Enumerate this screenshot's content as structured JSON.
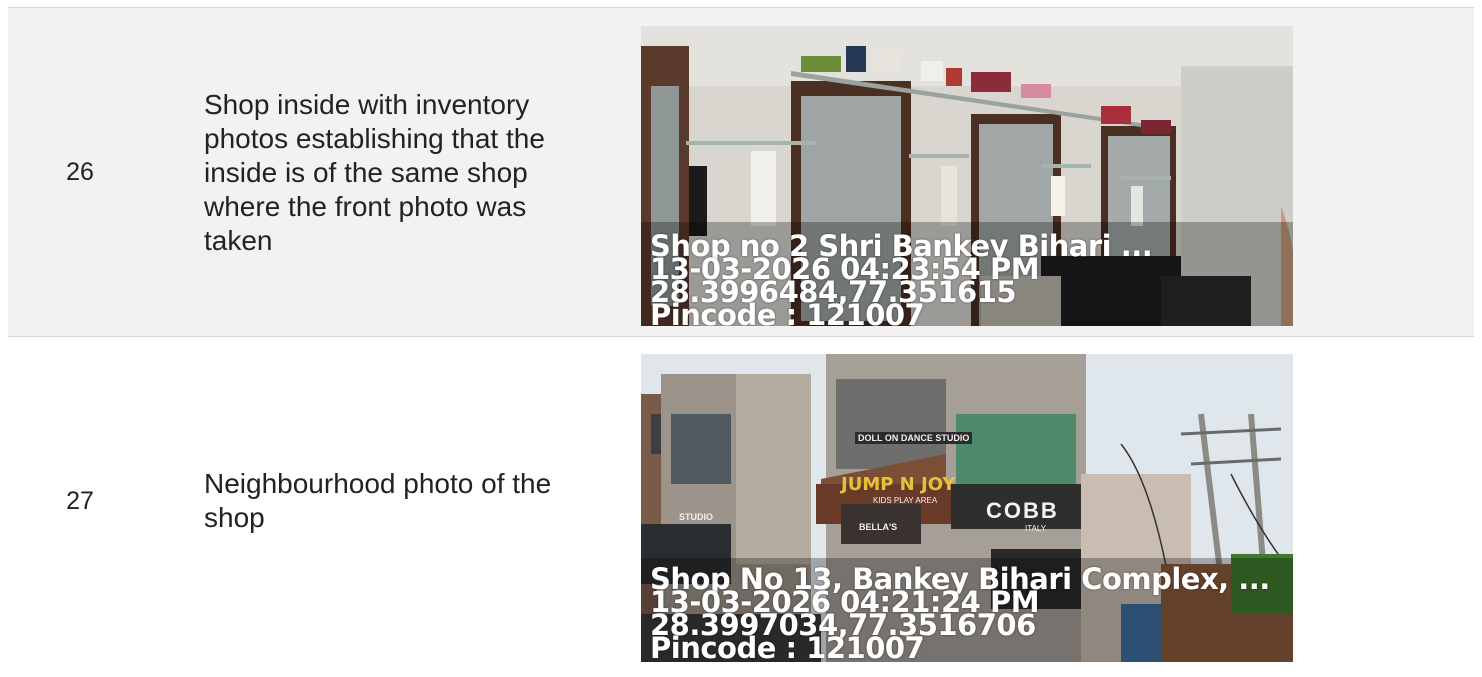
{
  "rows": [
    {
      "number": "26",
      "description": "Shop inside with inventory photos establishing that the inside is of the same shop where the front photo was taken",
      "photo": {
        "name": "shop-interior-photo",
        "overlay": {
          "location": "Shop no 2 Shri Bankey Bihari ...",
          "datetime": "13-03-2026 04:23:54 PM",
          "coordinates": "28.3996484,77.351615",
          "pincode": "Pincode : 121007"
        }
      }
    },
    {
      "number": "27",
      "description": "Neighbourhood photo of the shop",
      "photo": {
        "name": "neighbourhood-photo",
        "overlay": {
          "location": "Shop No 13, Bankey Bihari Complex, ...",
          "datetime": "13-03-2026 04:21:24 PM",
          "coordinates": "28.3997034,77.3516706",
          "pincode": "Pincode : 121007"
        },
        "signs": {
          "dance_studio": "DOLL ON DANCE STUDIO",
          "play_area": "JUMP N JOY",
          "play_area_sub": "KIDS PLAY AREA",
          "bellas": "BELLA'S",
          "cobb": "COBB",
          "cobb_sub": "ITALY",
          "studio": "STUDIO"
        }
      }
    }
  ]
}
